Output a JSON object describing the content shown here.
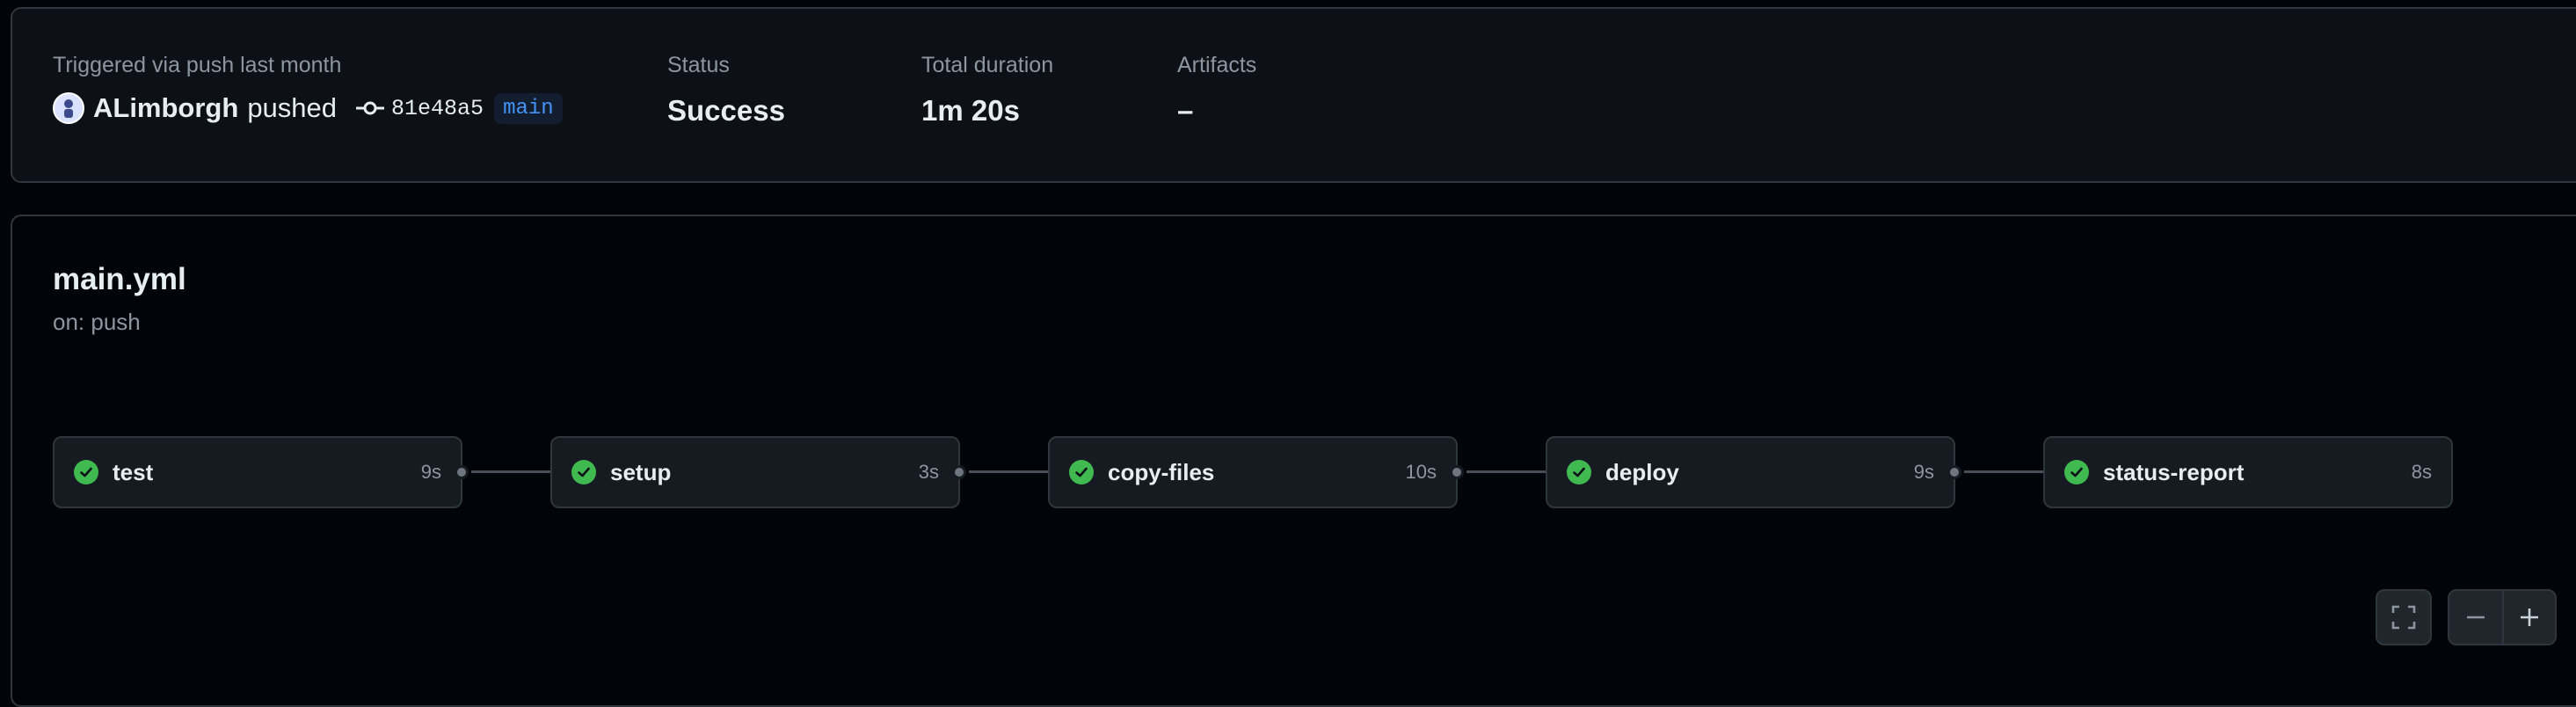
{
  "summary": {
    "trigger_label": "Triggered via push last month",
    "actor": "ALimborgh",
    "action": "pushed",
    "commit_sha": "81e48a5",
    "branch": "main",
    "status_label": "Status",
    "status_value": "Success",
    "duration_label": "Total duration",
    "duration_value": "1m 20s",
    "artifacts_label": "Artifacts",
    "artifacts_value": "–"
  },
  "workflow": {
    "file": "main.yml",
    "trigger": "on: push",
    "jobs": [
      {
        "name": "test",
        "duration": "9s",
        "status": "success"
      },
      {
        "name": "setup",
        "duration": "3s",
        "status": "success"
      },
      {
        "name": "copy-files",
        "duration": "10s",
        "status": "success"
      },
      {
        "name": "deploy",
        "duration": "9s",
        "status": "success"
      },
      {
        "name": "status-report",
        "duration": "8s",
        "status": "success"
      }
    ]
  },
  "controls": {
    "icons": [
      "fullscreen-icon",
      "zoom-out-icon",
      "zoom-in-icon"
    ]
  },
  "colors": {
    "success": "#3fb950",
    "branch_text": "#4493f8",
    "background": "#010409",
    "panel": "#0d1117"
  }
}
